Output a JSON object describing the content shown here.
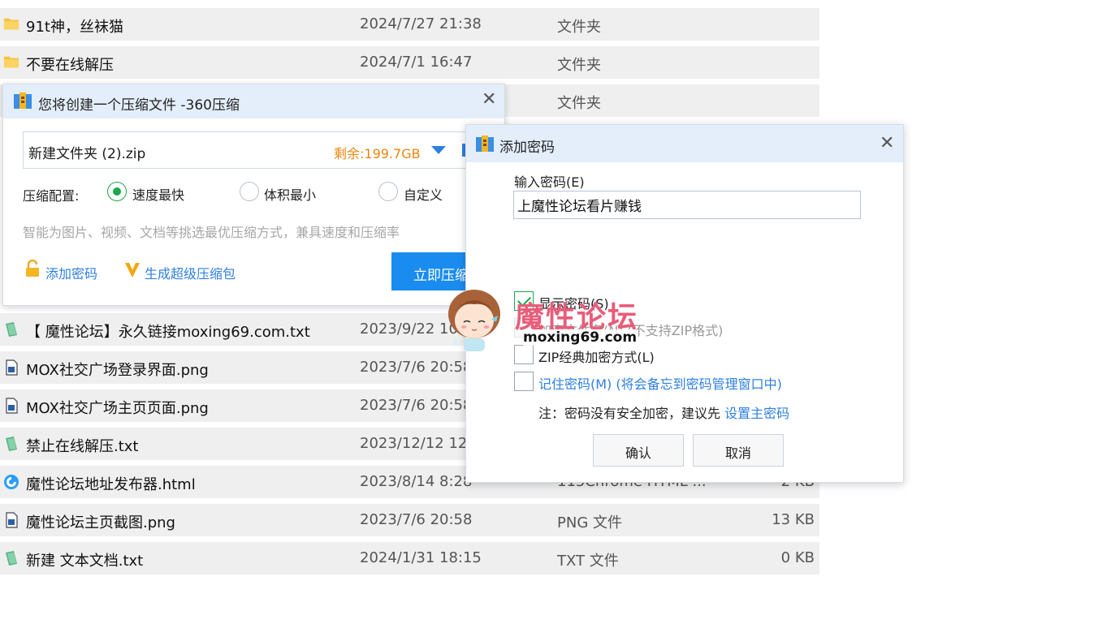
{
  "files": [
    {
      "name": "91t神，丝袜猫",
      "date": "2024/7/27 21:38",
      "type": "文件夹",
      "size": "",
      "icon": "folder-icon"
    },
    {
      "name": "不要在线解压",
      "date": "2024/7/1 16:47",
      "type": "文件夹",
      "size": "",
      "icon": "folder-icon"
    },
    {
      "name": "",
      "date": "",
      "type": "文件夹",
      "size": "",
      "icon": "folder-icon"
    },
    {
      "name": "【 魔性论坛】永久链接moxing69.com.txt",
      "date": "2023/9/22 10",
      "type": "",
      "size": "",
      "icon": "txt-file-icon"
    },
    {
      "name": "MOX社交广场登录界面.png",
      "date": "2023/7/6 20:58",
      "type": "",
      "size": "",
      "icon": "image-file-icon"
    },
    {
      "name": "MOX社交广场主页页面.png",
      "date": "2023/7/6 20:58",
      "type": "",
      "size": "",
      "icon": "image-file-icon"
    },
    {
      "name": "禁止在线解压.txt",
      "date": "2023/12/12 12",
      "type": "",
      "size": "",
      "icon": "txt-file-icon"
    },
    {
      "name": "魔性论坛地址发布器.html",
      "date": "2023/8/14 8:28",
      "type": "115Chrome HTML ...",
      "size": "2 KB",
      "icon": "browser-html-icon"
    },
    {
      "name": "魔性论坛主页截图.png",
      "date": "2023/7/6 20:58",
      "type": "PNG 文件",
      "size": "13 KB",
      "icon": "image-file-icon"
    },
    {
      "name": "新建 文本文档.txt",
      "date": "2024/1/31 18:15",
      "type": "TXT 文件",
      "size": "0 KB",
      "icon": "txt-file-icon"
    }
  ],
  "zip_dialog": {
    "title": "您将创建一个压缩文件 -360压缩",
    "filename": "新建文件夹 (2).zip",
    "free_space": "剩余:199.7GB",
    "config_label": "压缩配置:",
    "options": [
      "速度最快",
      "体积最小",
      "自定义"
    ],
    "selected_option": "速度最快",
    "hint": "智能为图片、视频、文档等挑选最优压缩方式，兼具速度和压缩率",
    "add_password": "添加密码",
    "super_package": "生成超级压缩包",
    "compress_button": "立即压缩"
  },
  "password_dialog": {
    "title": "添加密码",
    "input_label": "输入密码(E)",
    "password_value": "上魔性论坛看片赚钱",
    "show_password": "显示密码(S)",
    "show_password_checked": true,
    "encrypt_filenames": "加密文件名(N) (不支持ZIP格式)",
    "zip_classic": "ZIP经典加密方式(L)",
    "remember_password": "记住密码(M) (将会备忘到密码管理窗口中)",
    "note_prefix": "注：密码没有安全加密，建议先",
    "note_link": "设置主密码",
    "ok_button": "确认",
    "cancel_button": "取消"
  },
  "watermark": {
    "title": "魔性论坛",
    "url": "moxing69.com"
  },
  "colors": {
    "accent_blue": "#2f7fe0",
    "primary_button": "#1a8cf0",
    "free_space_orange": "#e8850c",
    "radio_green": "#1aa84a",
    "watermark_pink": "#e85d7a",
    "row_bg": "#efefef",
    "titlebar_bg": "#e4eefb"
  }
}
